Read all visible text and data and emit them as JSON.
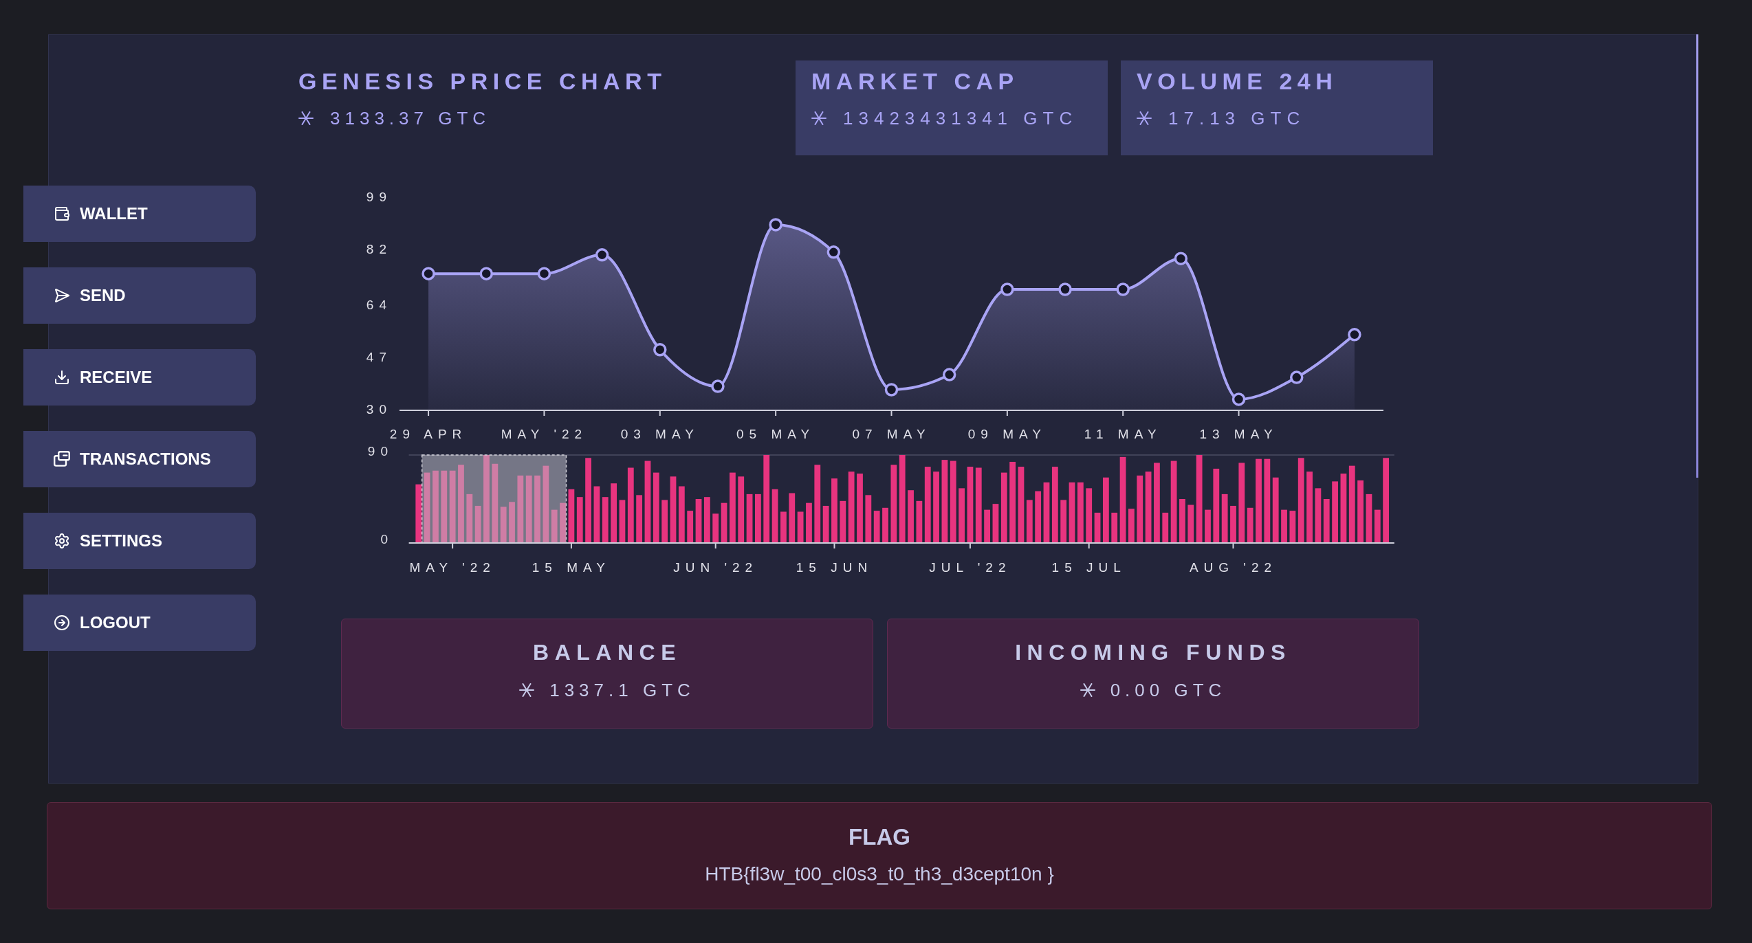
{
  "sidebar": {
    "items": [
      {
        "label": "WALLET"
      },
      {
        "label": "SEND"
      },
      {
        "label": "RECEIVE"
      },
      {
        "label": "TRANSACTIONS"
      },
      {
        "label": "SETTINGS"
      },
      {
        "label": "LOGOUT"
      }
    ]
  },
  "header": {
    "title": "GENESIS PRICE CHART",
    "price": "3133.37 GTC"
  },
  "stats": [
    {
      "label": "MARKET CAP",
      "value": "13423431341 GTC"
    },
    {
      "label": "VOLUME 24H",
      "value": "17.13 GTC"
    }
  ],
  "price_chart": {
    "chart_data": {
      "type": "area",
      "categories": [
        "29 APR",
        null,
        "MAY '22",
        null,
        "03 MAY",
        null,
        "05 MAY",
        null,
        "07 MAY",
        null,
        "09 MAY",
        null,
        "11 MAY",
        null,
        "13 MAY",
        null,
        null
      ],
      "series": [
        {
          "color": "#a9a4f5",
          "values": [
            74.4,
            74.4,
            74.4,
            80.5,
            49.7,
            37.8,
            90.3,
            81.4,
            36.7,
            41.6,
            69.3,
            69.3,
            69.3,
            79.3,
            33.6,
            40.7,
            54.6
          ]
        }
      ],
      "ylim": [
        30,
        99
      ],
      "yticks": [
        30,
        47,
        64,
        82,
        99
      ]
    }
  },
  "volume_chart": {
    "chart_data": {
      "type": "bar",
      "categories": [
        null,
        null,
        null,
        null,
        "MAY '22",
        null,
        null,
        null,
        null,
        null,
        null,
        null,
        null,
        null,
        null,
        null,
        null,
        null,
        "15 MAY",
        null,
        null,
        null,
        null,
        null,
        null,
        null,
        null,
        null,
        null,
        null,
        null,
        null,
        null,
        null,
        null,
        "JUN '22",
        null,
        null,
        null,
        null,
        null,
        null,
        null,
        null,
        null,
        null,
        null,
        null,
        null,
        "15 JUN",
        null,
        null,
        null,
        null,
        null,
        null,
        null,
        null,
        null,
        null,
        null,
        null,
        null,
        null,
        null,
        "JUL '22",
        null,
        null,
        null,
        null,
        null,
        null,
        null,
        null,
        null,
        null,
        null,
        null,
        null,
        "15 JUL",
        null,
        null,
        null,
        null,
        null,
        null,
        null,
        null,
        null,
        null,
        null,
        null,
        null,
        null,
        null,
        null,
        "AUG '22",
        null,
        null,
        null,
        null,
        null,
        null,
        null,
        null,
        null,
        null,
        null,
        null,
        null,
        null,
        null,
        null,
        null,
        null
      ],
      "series": [
        {
          "color": "#e8347f",
          "values": [
            60,
            72,
            74,
            74,
            74,
            80,
            50,
            38,
            90,
            81,
            37,
            42,
            69,
            69,
            69,
            79,
            34,
            41,
            55,
            47,
            87,
            58,
            47,
            61,
            44,
            77,
            49,
            84,
            72,
            44,
            68,
            58,
            33,
            45,
            47,
            30,
            41,
            72,
            68,
            50,
            50,
            90,
            55,
            32,
            51,
            32,
            41,
            80,
            38,
            66,
            43,
            73,
            71,
            49,
            33,
            36,
            80,
            90,
            54,
            43,
            78,
            73,
            85,
            84,
            56,
            78,
            77,
            34,
            40,
            72,
            83,
            78,
            44,
            53,
            62,
            78,
            44,
            62,
            62,
            56,
            31,
            67,
            31,
            88,
            35,
            69,
            73,
            82,
            31,
            84,
            45,
            39,
            90,
            34,
            76,
            50,
            38,
            82,
            36,
            86,
            86,
            67,
            34,
            33,
            87,
            73,
            56,
            45,
            63,
            71,
            79,
            64,
            50,
            34,
            87
          ]
        }
      ],
      "ylim": [
        0,
        90
      ],
      "yticks": [
        0,
        90
      ]
    }
  },
  "balances": [
    {
      "label": "BALANCE",
      "value": "1337.1 GTC"
    },
    {
      "label": "INCOMING FUNDS",
      "value": "0.00 GTC"
    }
  ],
  "flag": {
    "title": "FLAG",
    "value": "HTB{fl3w_t00_cl0s3_t0_th3_d3cept10n }"
  }
}
